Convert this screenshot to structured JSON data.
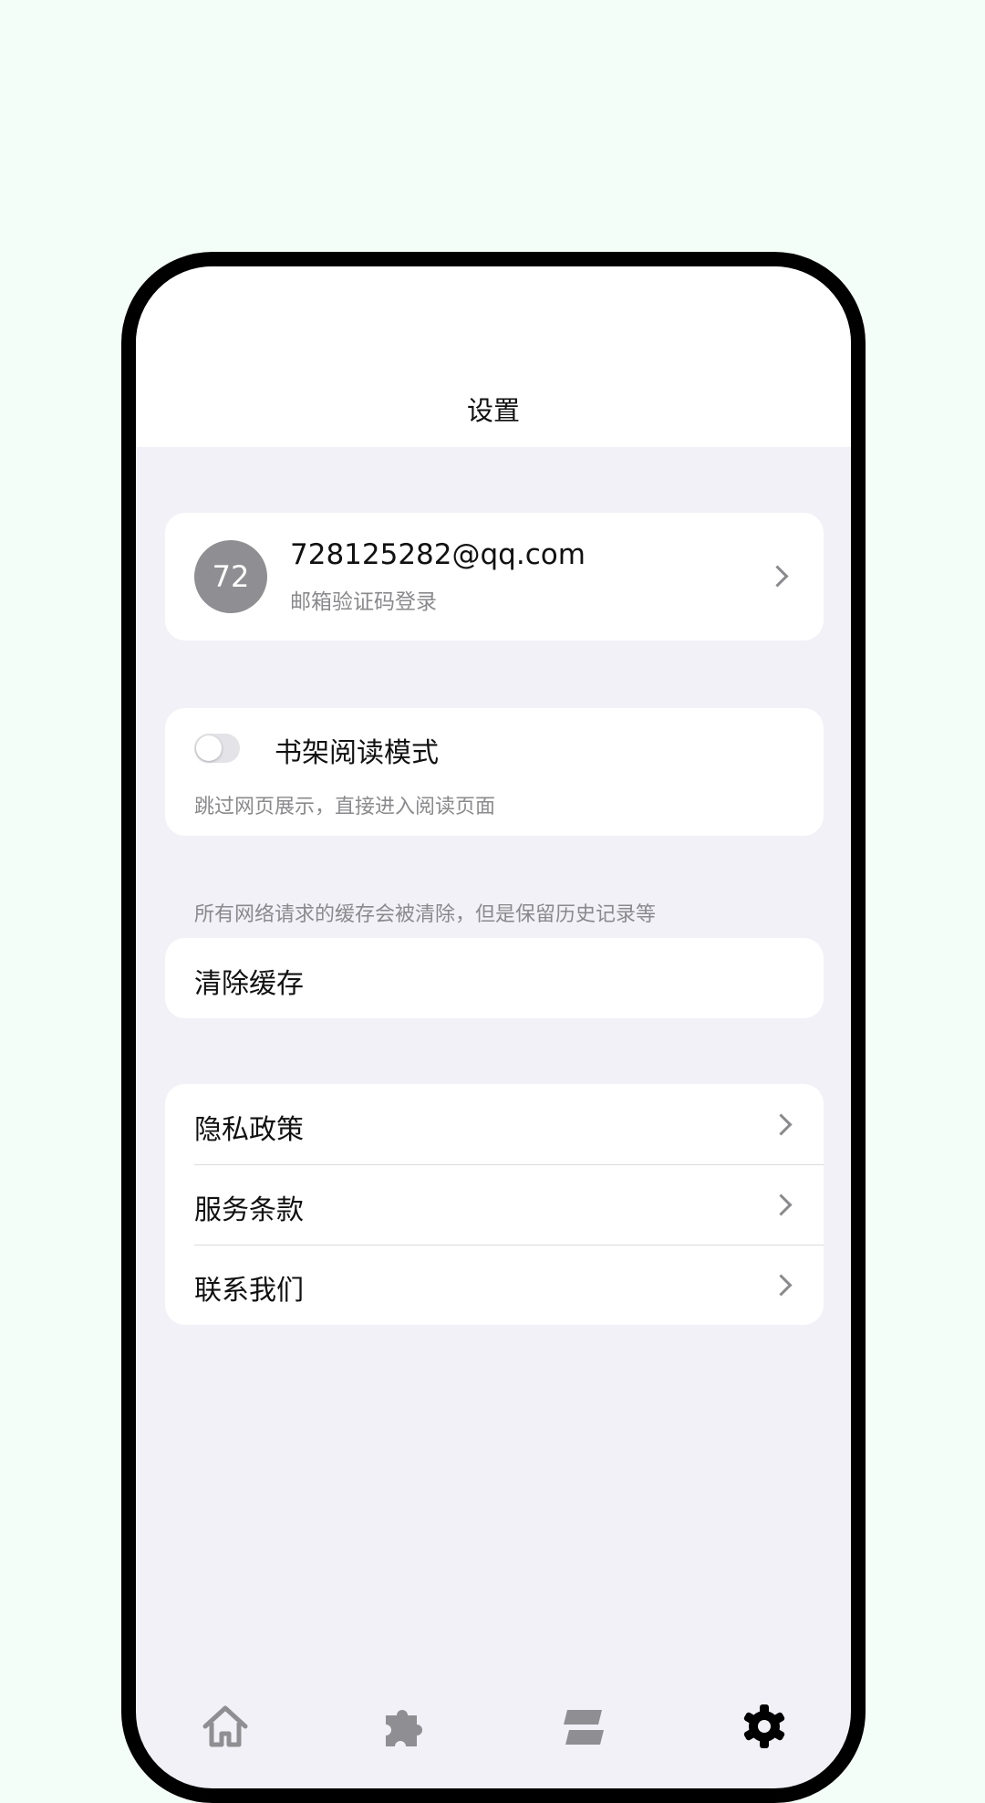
{
  "header": {
    "title": "设置"
  },
  "account": {
    "avatar_text": "72",
    "email": "728125282@qq.com",
    "login_method": "邮箱验证码登录"
  },
  "reader_mode": {
    "label": "书架阅读模式",
    "description": "跳过网页展示，直接进入阅读页面",
    "enabled": false
  },
  "cache": {
    "note": "所有网络请求的缓存会被清除，但是保留历史记录等",
    "clear_label": "清除缓存"
  },
  "links": [
    {
      "label": "隐私政策"
    },
    {
      "label": "服务条款"
    },
    {
      "label": "联系我们"
    }
  ],
  "tabbar": {
    "tabs": [
      {
        "icon": "home-icon",
        "active": false
      },
      {
        "icon": "puzzle-icon",
        "active": false
      },
      {
        "icon": "shelf-icon",
        "active": false
      },
      {
        "icon": "gear-icon",
        "active": true
      }
    ],
    "colors": {
      "active": "#000000",
      "inactive": "#8e8e93"
    }
  },
  "colors": {
    "page_background": "#f3fef8",
    "screen_background": "#f1f1f7",
    "avatar": "#8e8e93"
  }
}
